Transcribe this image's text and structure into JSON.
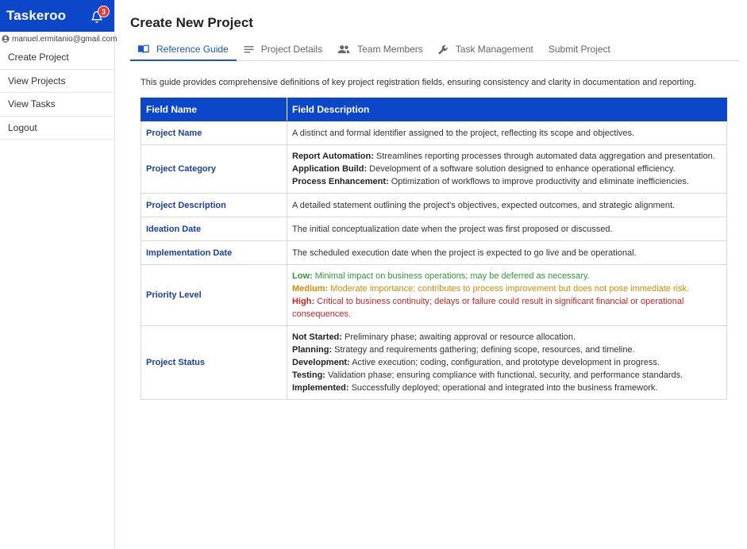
{
  "app": {
    "brand": "Taskeroo",
    "notification_count": "3",
    "user_email": "manuel.ermitanio@gmail.com"
  },
  "sidebar": {
    "items": [
      {
        "label": "Create Project"
      },
      {
        "label": "View Projects"
      },
      {
        "label": "View Tasks"
      },
      {
        "label": "Logout"
      }
    ]
  },
  "page": {
    "title": "Create New Project",
    "tabs": [
      {
        "label": "Reference Guide",
        "icon": "book-icon",
        "active": true
      },
      {
        "label": "Project Details",
        "icon": "list-icon",
        "active": false
      },
      {
        "label": "Team Members",
        "icon": "people-icon",
        "active": false
      },
      {
        "label": "Task Management",
        "icon": "wrench-icon",
        "active": false
      },
      {
        "label": "Submit Project",
        "icon": "",
        "active": false
      }
    ],
    "intro": "This guide provides comprehensive definitions of key project registration fields, ensuring consistency and clarity in documentation and reporting."
  },
  "table": {
    "headers": [
      "Field Name",
      "Field Description"
    ],
    "rows": [
      {
        "field": "Project Name",
        "lines": [
          {
            "label": "",
            "text": "A distinct and formal identifier assigned to the project, reflecting its scope and objectives."
          }
        ]
      },
      {
        "field": "Project Category",
        "lines": [
          {
            "label": "Report Automation:",
            "text": " Streamlines reporting processes through automated data aggregation and presentation."
          },
          {
            "label": "Application Build:",
            "text": " Development of a software solution designed to enhance operational efficiency."
          },
          {
            "label": "Process Enhancement:",
            "text": " Optimization of workflows to improve productivity and eliminate inefficiencies."
          }
        ]
      },
      {
        "field": "Project Description",
        "lines": [
          {
            "label": "",
            "text": "A detailed statement outlining the project's objectives, expected outcomes, and strategic alignment."
          }
        ]
      },
      {
        "field": "Ideation Date",
        "lines": [
          {
            "label": "",
            "text": "The initial conceptualization date when the project was first proposed or discussed."
          }
        ]
      },
      {
        "field": "Implementation Date",
        "lines": [
          {
            "label": "",
            "text": "The scheduled execution date when the project is expected to go live and be operational."
          }
        ]
      },
      {
        "field": "Priority Level",
        "lines": [
          {
            "label": "Low:",
            "text": " Minimal impact on business operations; may be deferred as necessary.",
            "level": "low"
          },
          {
            "label": "Medium:",
            "text": " Moderate importance; contributes to process improvement but does not pose immediate risk.",
            "level": "med"
          },
          {
            "label": "High:",
            "text": " Critical to business continuity; delays or failure could result in significant financial or operational consequences.",
            "level": "high"
          }
        ]
      },
      {
        "field": "Project Status",
        "lines": [
          {
            "label": "Not Started:",
            "text": " Preliminary phase; awaiting approval or resource allocation."
          },
          {
            "label": "Planning:",
            "text": " Strategy and requirements gathering; defining scope, resources, and timeline."
          },
          {
            "label": "Development:",
            "text": " Active execution; coding, configuration, and prototype development in progress."
          },
          {
            "label": "Testing:",
            "text": " Validation phase; ensuring compliance with functional, security, and performance standards."
          },
          {
            "label": "Implemented:",
            "text": " Successfully deployed; operational and integrated into the business framework."
          }
        ]
      }
    ]
  },
  "colors": {
    "primary": "#0d47c9",
    "field_name": "#1a3fa8",
    "low": "#2e9c3a",
    "medium": "#d98a00",
    "high": "#d32020",
    "badge": "#e53935"
  }
}
